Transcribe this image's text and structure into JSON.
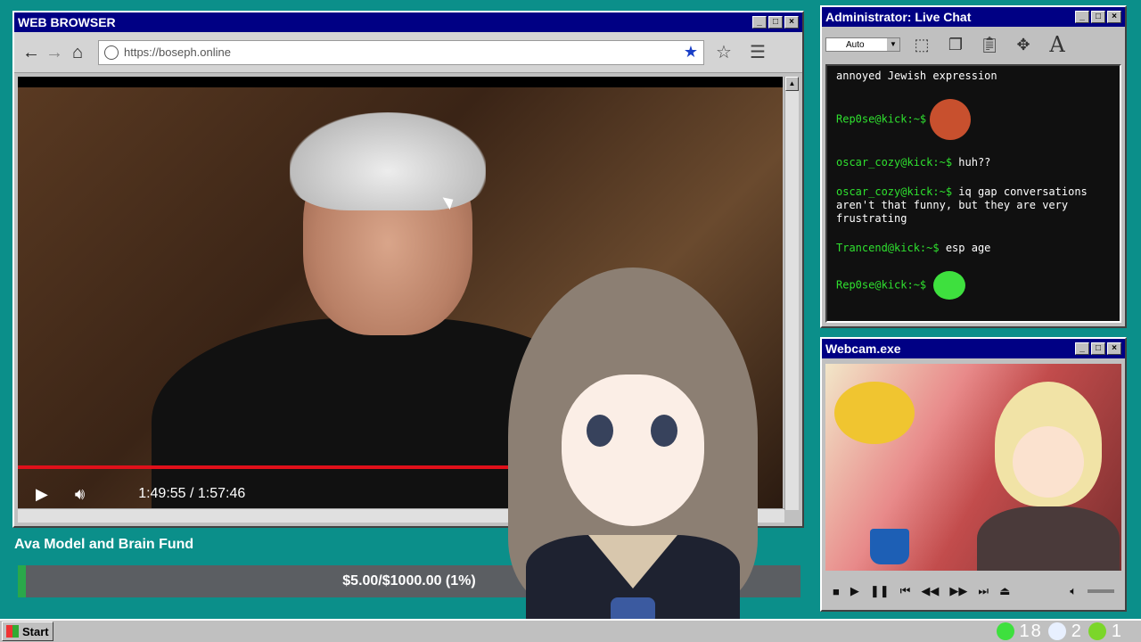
{
  "browser": {
    "title": "WEB BROWSER",
    "url": "https://boseph.online",
    "video": {
      "time": "1:49:55 / 1:57:46",
      "progress": 0.954
    }
  },
  "fund": {
    "title": "Ava Model and Brain Fund",
    "amount": "$5.00/$1000.00 (1%)",
    "progress": 0.01
  },
  "chat": {
    "title": "Administrator: Live Chat",
    "select_value": "Auto",
    "messages": [
      {
        "user": "",
        "text": "annoyed Jewish expression"
      },
      {
        "user": "Rep0se@kick:~$",
        "text": "",
        "emote": "face-emote"
      },
      {
        "user": "oscar_cozy@kick:~$",
        "text": "huh??"
      },
      {
        "user": "oscar_cozy@kick:~$",
        "text": "iq gap conversations aren't that funny, but they are very frustrating"
      },
      {
        "user": "Trancend@kick:~$",
        "text": "esp age"
      },
      {
        "user": "Rep0se@kick:~$",
        "text": "",
        "emote": "green-emote"
      }
    ]
  },
  "webcam": {
    "title": "Webcam.exe"
  },
  "taskbar": {
    "start_label": "Start",
    "kick_count": "18",
    "moon_count": "2",
    "play_count": "1"
  },
  "colors": {
    "desktop": "#0b8f8a",
    "titlebar": "#000084",
    "chat_user": "#2fe02f",
    "progress": "#e0101a"
  }
}
